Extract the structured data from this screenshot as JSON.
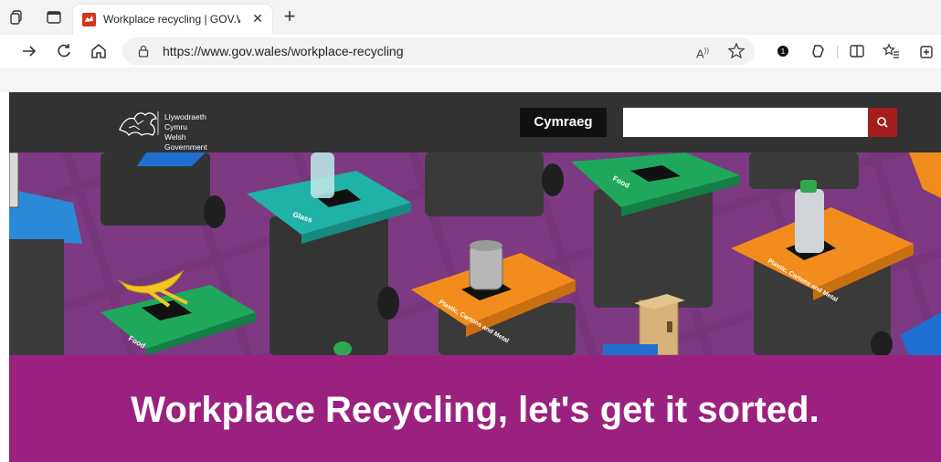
{
  "browser": {
    "tab": {
      "title": "Workplace recycling | GOV.WALE",
      "favicon": "gov-wales-favicon-icon"
    },
    "url": "https://www.gov.wales/workplace-recycling",
    "icons": [
      "workspaces-icon",
      "tab-actions-icon",
      "back-icon",
      "refresh-icon",
      "home-icon",
      "lock-icon",
      "read-aloud-icon",
      "favorite-star-icon",
      "extension-badge-icon",
      "copilot-icon",
      "split-screen-icon",
      "favorites-icon",
      "collections-icon",
      "new-tab-plus-icon",
      "close-icon"
    ]
  },
  "site": {
    "logo": {
      "line1": "Llywodraeth Cymru",
      "line2": "Welsh Government"
    },
    "language_button": "Cymraeg",
    "search": {
      "value": "",
      "icon": "search-icon"
    },
    "colors": {
      "header": "#323232",
      "search_button": "#a41d1d",
      "banner": "#9b2180",
      "hero_bg": "#7f3b80"
    }
  },
  "hero": {
    "labels": [
      "Glass",
      "Food",
      "Plastic, Cartons and Metal",
      "Plastic, Cartons and Metal",
      "Food"
    ]
  },
  "banner": {
    "title": "Workplace Recycling, let's get it sorted."
  }
}
